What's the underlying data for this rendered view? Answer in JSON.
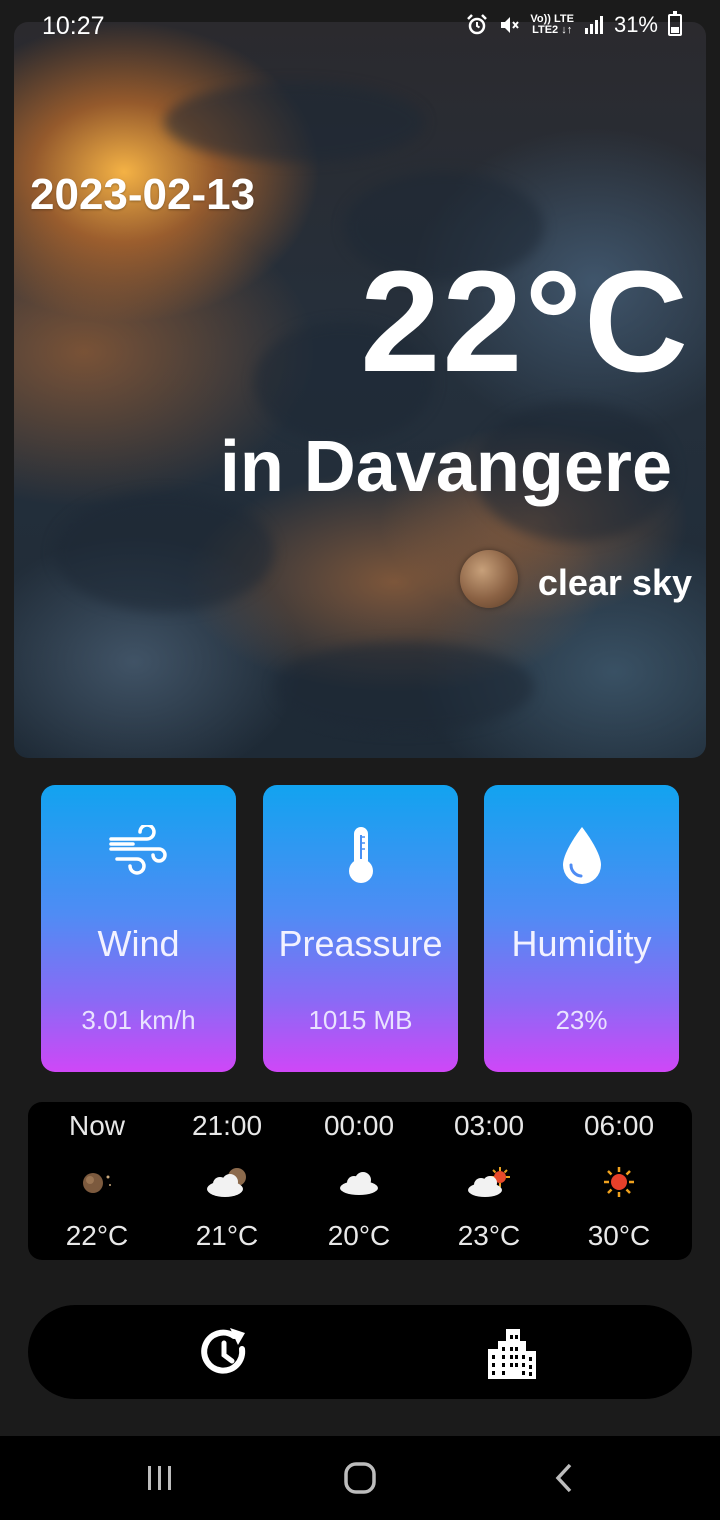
{
  "status_bar": {
    "time": "10:27",
    "network_top": "Vo)) LTE",
    "network_bottom": "LTE2 ↓↑",
    "battery": "31%"
  },
  "hero": {
    "date": "2023-02-13",
    "temperature": "22°C",
    "location": "in Davangere",
    "description": "clear sky",
    "icon": "moon-icon"
  },
  "stats": [
    {
      "icon": "wind-icon",
      "label": "Wind",
      "value": "3.01 km/h"
    },
    {
      "icon": "thermometer-icon",
      "label": "Preassure",
      "value": "1015 MB"
    },
    {
      "icon": "water-drop-icon",
      "label": "Humidity",
      "value": "23%"
    }
  ],
  "forecast": [
    {
      "time": "Now",
      "icon": "night-clear-icon",
      "temp": "22°C"
    },
    {
      "time": "21:00",
      "icon": "night-partly-cloudy-icon",
      "temp": "21°C"
    },
    {
      "time": "00:00",
      "icon": "cloud-icon",
      "temp": "20°C"
    },
    {
      "time": "03:00",
      "icon": "partly-sunny-icon",
      "temp": "23°C"
    },
    {
      "time": "06:00",
      "icon": "sun-icon",
      "temp": "30°C"
    }
  ],
  "actions": [
    {
      "icon": "refresh-clock-icon"
    },
    {
      "icon": "city-buildings-icon"
    }
  ],
  "colors": {
    "card_gradient_top": "#12a3f0",
    "card_gradient_bottom": "#cf47f7",
    "background": "#1b1b1b"
  }
}
